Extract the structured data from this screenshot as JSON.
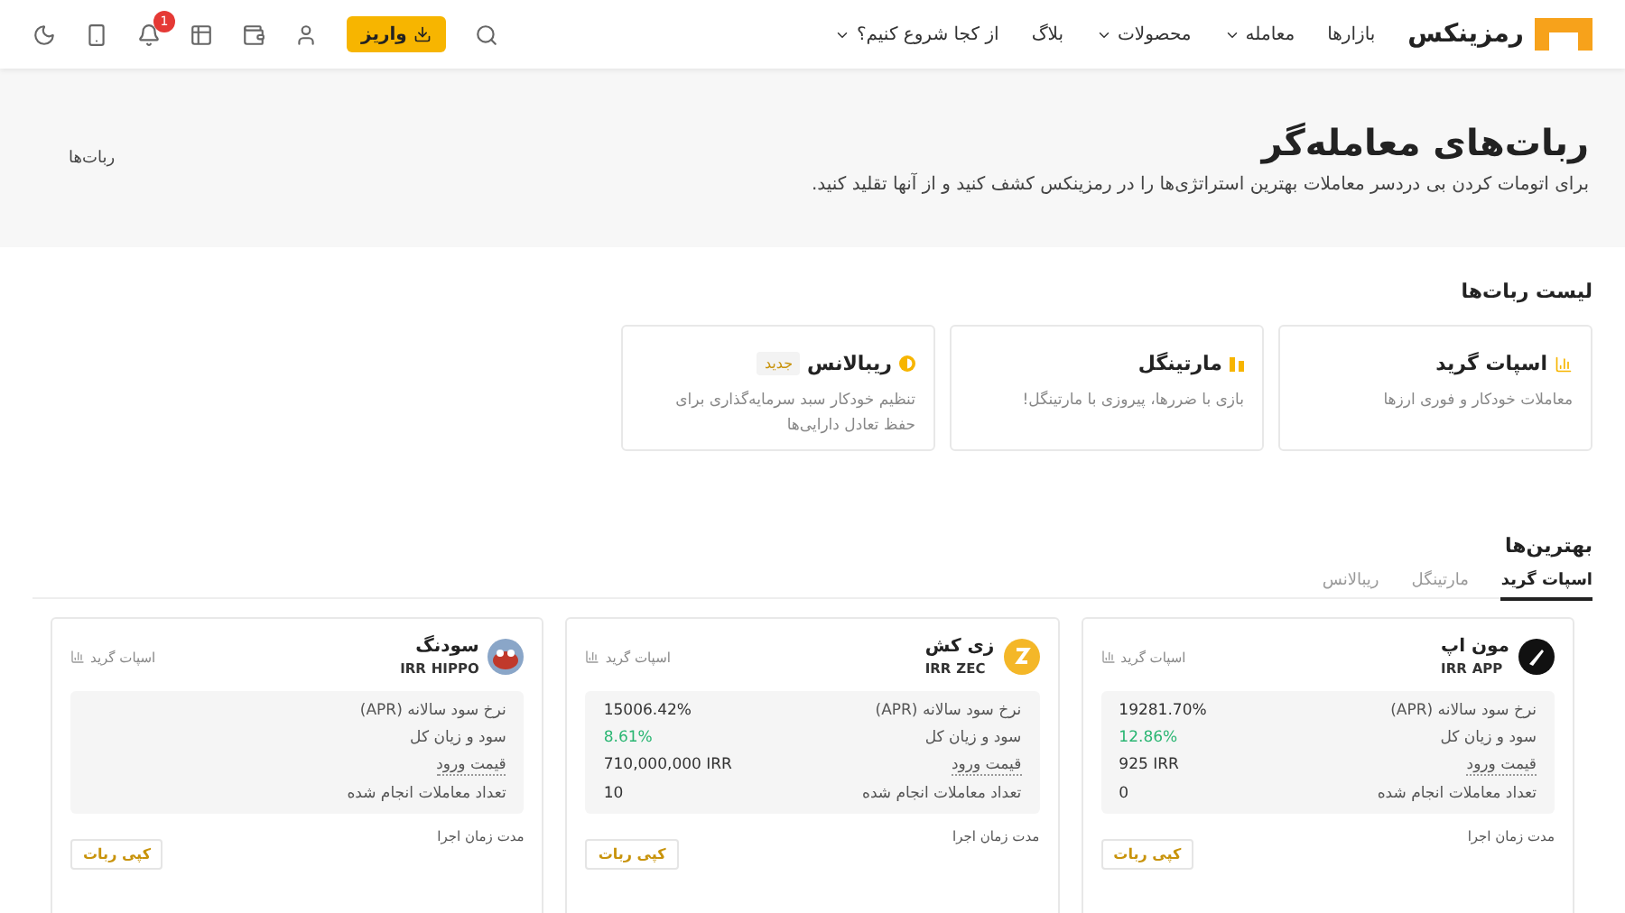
{
  "header": {
    "logo_text": "رمزینکس",
    "nav": [
      {
        "label": "بازارها",
        "caret": false
      },
      {
        "label": "معامله",
        "caret": true
      },
      {
        "label": "محصولات",
        "caret": true
      },
      {
        "label": "بلاگ",
        "caret": false
      },
      {
        "label": "از کجا شروع کنیم؟",
        "caret": true
      }
    ],
    "deposit_button": "واریز",
    "notification_count": "1"
  },
  "hero": {
    "title": "ربات‌های معامله‌گر",
    "subtitle": "برای اتومات کردن بی دردسر معاملات بهترین استراتژی‌ها را در رمزینکس کشف کنید و از آنها تقلید کنید.",
    "image_alt": "ربات‌ها"
  },
  "bot_types": {
    "title": "لیست ربات‌ها",
    "items": [
      {
        "kind": "grid",
        "name": "اسپات گرید",
        "description": "معاملات خودکار و فوری ارزها"
      },
      {
        "kind": "martingale",
        "name": "مارتینگل",
        "description": "بازی با ضررها، پیروزی با مارتینگل!"
      },
      {
        "kind": "rebalance",
        "name": "ریبالانس",
        "badge": "جدید",
        "description": "تنظیم خودکار سبد سرمایه‌گذاری برای حفظ تعادل دارایی‌ها"
      }
    ]
  },
  "best": {
    "title": "بهترین‌ها",
    "tabs": [
      {
        "label": "اسپات گرید",
        "selected": true
      },
      {
        "label": "مارتینگل",
        "selected": false
      },
      {
        "label": "ریبالانس",
        "selected": false
      }
    ],
    "bots": [
      {
        "kind": "rocket",
        "name": "مون اپ",
        "base": "APP",
        "quote": "IRR",
        "type": "اسپات گرید",
        "stats": [
          {
            "label": "نرخ سود سالانه (APR)",
            "value": "19281.70%",
            "kind": "plain"
          },
          {
            "label": "سود و زیان کل",
            "value": "12.86%",
            "kind": "positive"
          },
          {
            "label": "قیمت ورود",
            "value": "925 IRR",
            "kind": "plain"
          },
          {
            "label": "تعداد معاملات انجام شده",
            "value": "0",
            "kind": "plain"
          }
        ],
        "runtime_label": "مدت زمان اجرا",
        "copy_button": "کپی ربات"
      },
      {
        "kind": "coin",
        "name": "زی کش",
        "base": "ZEC",
        "quote": "IRR",
        "type": "اسپات گرید",
        "stats": [
          {
            "label": "نرخ سود سالانه (APR)",
            "value": "15006.42%",
            "kind": "plain"
          },
          {
            "label": "سود و زیان کل",
            "value": "8.61%",
            "kind": "positive"
          },
          {
            "label": "قیمت ورود",
            "value": "710,000,000 IRR",
            "kind": "plain"
          },
          {
            "label": "تعداد معاملات انجام شده",
            "value": "10",
            "kind": "plain"
          }
        ],
        "runtime_label": "مدت زمان اجرا",
        "copy_button": "کپی ربات"
      },
      {
        "kind": "hippo",
        "name": "سودنگ",
        "base": "HIPPO",
        "quote": "IRR",
        "type": "اسپات گرید",
        "stats": [
          {
            "label": "نرخ سود سالانه (APR)"
          },
          {
            "label": "سود و زیان کل"
          },
          {
            "label": "قیمت ورود"
          },
          {
            "label": "تعداد معاملات انجام شده"
          }
        ],
        "runtime_label": "مدت زمان اجرا",
        "copy_button": "کپی ربات"
      }
    ]
  }
}
